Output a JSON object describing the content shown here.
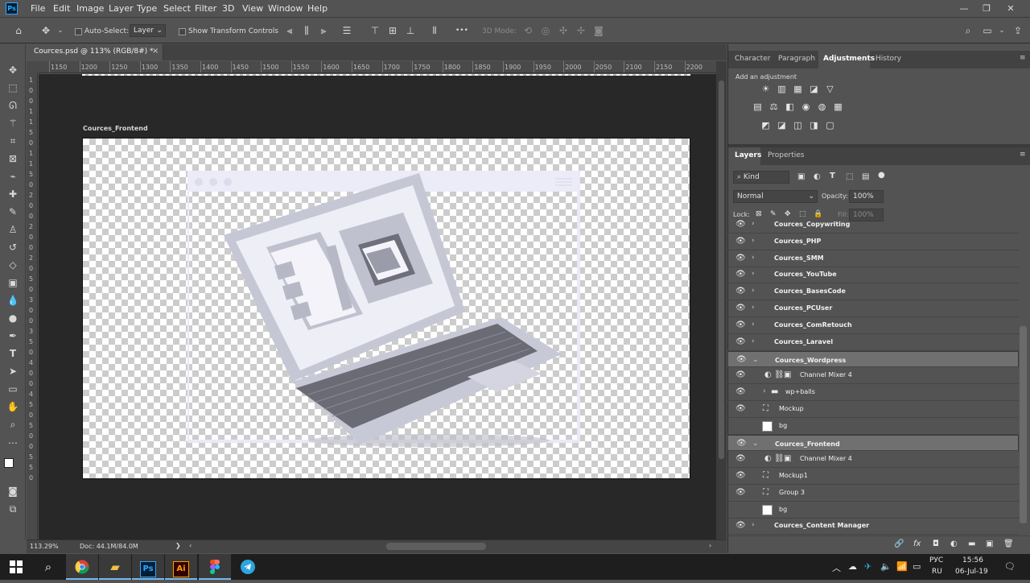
{
  "app": {
    "logo": "Ps"
  },
  "menu": [
    "File",
    "Edit",
    "Image",
    "Layer",
    "Type",
    "Select",
    "Filter",
    "3D",
    "View",
    "Window",
    "Help"
  ],
  "window_controls": {
    "minimize": "—",
    "restore": "❐",
    "close": "✕"
  },
  "options": {
    "auto_select_label": "Auto-Select:",
    "auto_select_value": "Layer",
    "transform_label": "Show Transform Controls",
    "mode_3d_label": "3D Mode:",
    "more": "•••"
  },
  "document": {
    "tab_title": "Cources.psd @ 113% (RGB/8#) *",
    "close": "×",
    "artboard_name": "Cources_Frontend"
  },
  "ruler_top": [
    "1150",
    "1200",
    "1250",
    "1300",
    "1350",
    "1400",
    "1450",
    "1500",
    "1550",
    "1600",
    "1650",
    "1700",
    "1750",
    "1800",
    "1850",
    "1900",
    "1950",
    "2000",
    "2050",
    "2100",
    "2150",
    "2200"
  ],
  "ruler_left": [
    "1",
    "0",
    "0",
    "1",
    "1",
    "5",
    "0",
    "1",
    "1",
    "5",
    "0",
    "2",
    "0",
    "0",
    "2",
    "0",
    "0",
    "2",
    "0",
    "5",
    "0",
    "3",
    "0",
    "0",
    "3",
    "5",
    "0",
    "4",
    "0",
    "0",
    "4",
    "5",
    "0",
    "5",
    "0",
    "0",
    "5",
    "5",
    "0"
  ],
  "status": {
    "zoom": "113.29%",
    "doc": "Doc: 44.1M/84.0M",
    "arrow": "❯"
  },
  "adjustments_panel": {
    "tabs": [
      "Character",
      "Paragraph",
      "Adjustments",
      "History"
    ],
    "active_tab": "Adjustments",
    "add_label": "Add an adjustment",
    "row1": [
      "☀",
      "▥",
      "▦",
      "◪",
      "▽"
    ],
    "row2": [
      "▤",
      "⚖",
      "◧",
      "◉",
      "◍",
      "▦"
    ],
    "row3": [
      "◩",
      "◪",
      "◫",
      "◨",
      "▢"
    ]
  },
  "layers_panel": {
    "tabs": [
      "Layers",
      "Properties"
    ],
    "active_tab": "Layers",
    "filter_kind": "Kind",
    "blend_mode": "Normal",
    "opacity_label": "Opacity:",
    "opacity_value": "100%",
    "lock_label": "Lock:",
    "fill_label": "Fill:",
    "fill_value": "100%",
    "layers": [
      {
        "name": "Cources_Copywriting",
        "type": "artboard",
        "visible": true
      },
      {
        "name": "Cources_PHP",
        "type": "artboard",
        "visible": true
      },
      {
        "name": "Cources_SMM",
        "type": "artboard",
        "visible": true
      },
      {
        "name": "Cources_YouTube",
        "type": "artboard",
        "visible": true
      },
      {
        "name": "Cources_BasesCode",
        "type": "artboard",
        "visible": true
      },
      {
        "name": "Cources_PCUser",
        "type": "artboard",
        "visible": true
      },
      {
        "name": "Cources_ComRetouch",
        "type": "artboard",
        "visible": true
      },
      {
        "name": "Cources_Laravel",
        "type": "artboard",
        "visible": true
      },
      {
        "name": "Cources_Wordpress",
        "type": "artboard-open",
        "visible": true,
        "selected": true
      },
      {
        "name": "Channel Mixer 4",
        "type": "adjust",
        "visible": true
      },
      {
        "name": "wp+balls",
        "type": "folder",
        "visible": true
      },
      {
        "name": "Mockup",
        "type": "smart",
        "visible": true
      },
      {
        "name": "bg",
        "type": "white",
        "visible": false
      },
      {
        "name": "Cources_Frontend",
        "type": "artboard-open",
        "visible": true,
        "selected": true
      },
      {
        "name": "Channel Mixer 4",
        "type": "adjust",
        "visible": true
      },
      {
        "name": "Mockup1",
        "type": "smart",
        "visible": true
      },
      {
        "name": "Group 3",
        "type": "smart",
        "visible": true
      },
      {
        "name": "bg",
        "type": "white",
        "visible": false
      },
      {
        "name": "Cources_Content Manager",
        "type": "artboard",
        "visible": true
      }
    ],
    "footer_icons": [
      "🔗",
      "fx",
      "◘",
      "◐",
      "▬",
      "▣",
      "🗑"
    ]
  },
  "taskbar": {
    "apps": [
      "Chrome",
      "Explorer",
      "Ps",
      "Ai",
      "Figma",
      "Telegram"
    ],
    "lang_top": "РУС",
    "lang_bottom": "RU",
    "time": "15:56",
    "date": "06-Jul-19"
  }
}
